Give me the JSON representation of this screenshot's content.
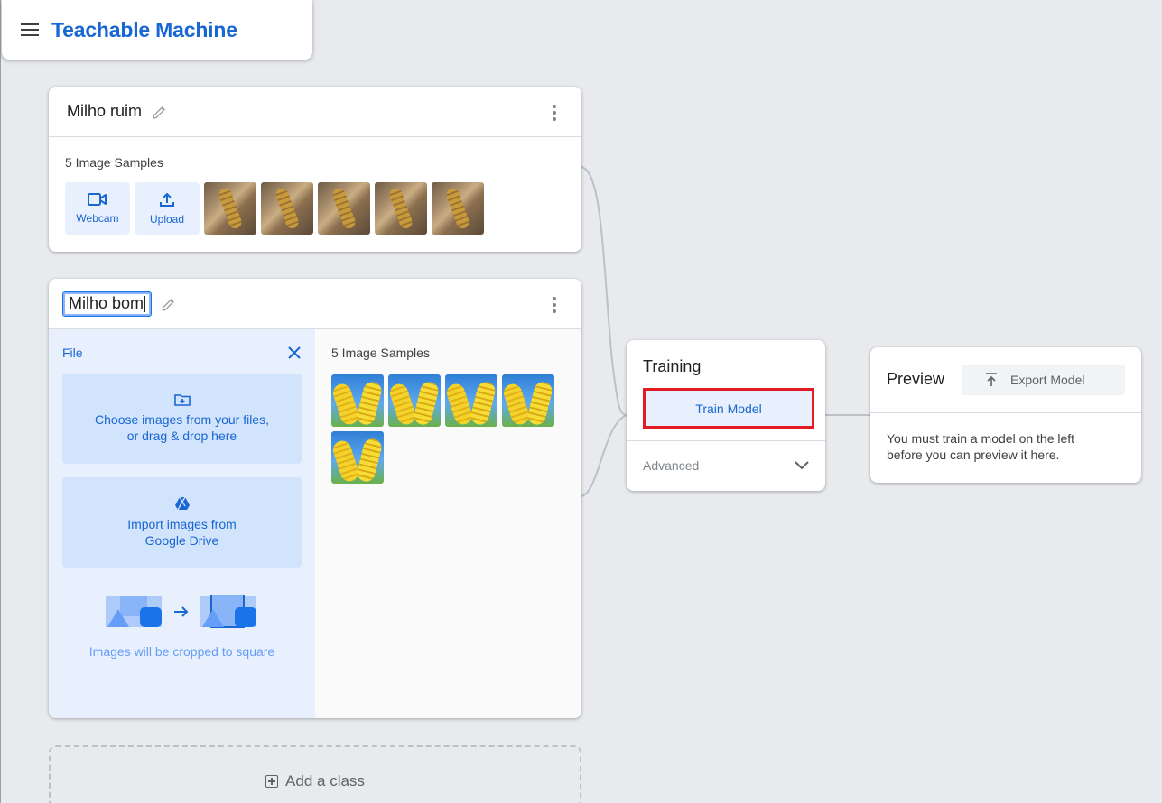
{
  "app": {
    "title": "Teachable Machine"
  },
  "classes": [
    {
      "name": "Milho ruim",
      "samples_label": "5 Image Samples",
      "webcam_label": "Webcam",
      "upload_label": "Upload",
      "thumbnails": [
        "corn-bad-1",
        "corn-bad-2",
        "corn-bad-3",
        "corn-bad-4",
        "corn-bad-5"
      ]
    },
    {
      "name": "Milho bom",
      "samples_label": "5 Image Samples",
      "upload_panel": {
        "file_label": "File",
        "choose_files": "Choose images from your files,\nor drag & drop here",
        "choose_files_line1": "Choose images from your files,",
        "choose_files_line2": "or drag & drop here",
        "drive_line1": "Import images from",
        "drive_line2": "Google Drive",
        "crop_note": "Images will be cropped to square"
      },
      "thumbnails": [
        "corn-good-1",
        "corn-good-2",
        "corn-good-3",
        "corn-good-4",
        "corn-good-5"
      ]
    }
  ],
  "add_class": {
    "label": "Add a class"
  },
  "training": {
    "title": "Training",
    "train_button": "Train Model",
    "advanced_label": "Advanced"
  },
  "preview": {
    "title": "Preview",
    "export_button": "Export Model",
    "message": "You must train a model on the left before you can preview it here."
  },
  "colors": {
    "accent": "#1967d2",
    "highlight_border": "#e31b23",
    "background": "#e8eaed"
  },
  "icons": [
    "menu-icon",
    "pencil-icon",
    "more-vert-icon",
    "webcam-icon",
    "upload-icon",
    "close-icon",
    "folder-add-icon",
    "google-drive-icon",
    "arrow-right-icon",
    "add-box-icon",
    "chevron-down-icon",
    "export-icon"
  ]
}
